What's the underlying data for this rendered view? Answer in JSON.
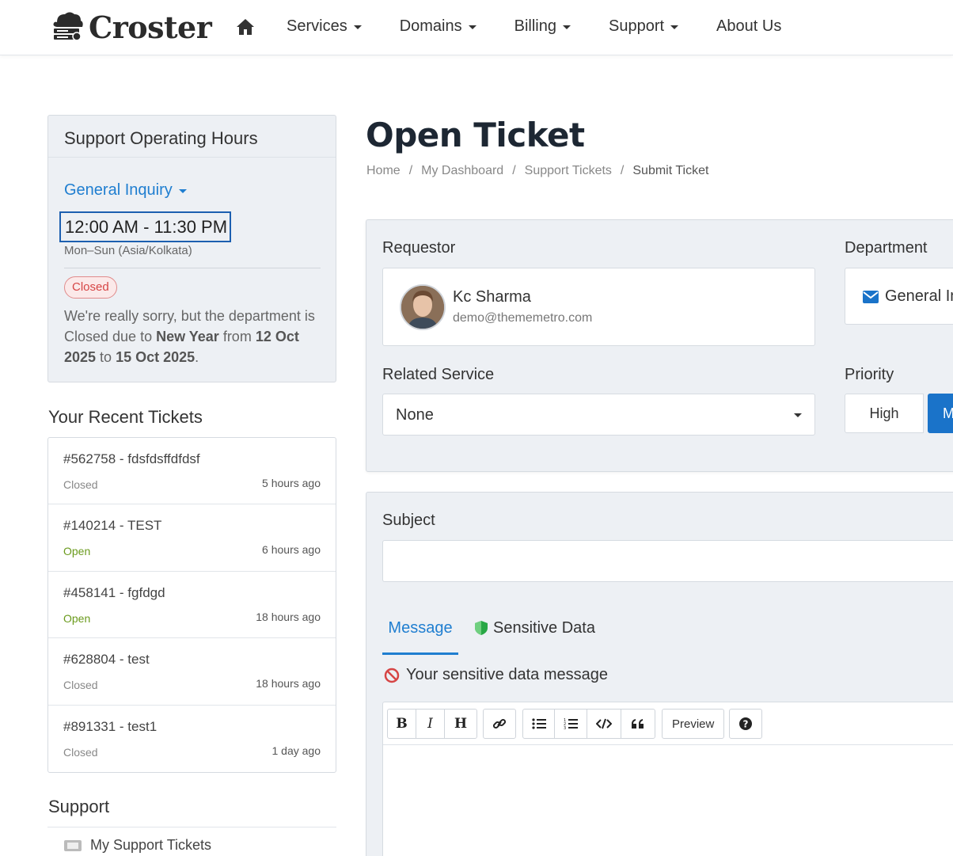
{
  "header": {
    "logo_text": "Croster",
    "nav": [
      {
        "label": "Services",
        "has_dropdown": true
      },
      {
        "label": "Domains",
        "has_dropdown": true
      },
      {
        "label": "Billing",
        "has_dropdown": true
      },
      {
        "label": "Support",
        "has_dropdown": true
      },
      {
        "label": "About Us",
        "has_dropdown": false
      }
    ]
  },
  "sidebar": {
    "hours_panel": {
      "title": "Support Operating Hours",
      "department": "General Inquiry",
      "hours": "12:00 AM - 11:30 PM",
      "days": "Mon–Sun (Asia/Kolkata)",
      "status": "Closed",
      "message": {
        "part1": "We're really sorry, but the department is Closed due to ",
        "reason": "New Year",
        "part2": " from ",
        "start": "12 Oct 2025",
        "part3": " to ",
        "end": "15 Oct 2025",
        "part4": "."
      }
    },
    "recent_title": "Your Recent Tickets",
    "tickets": [
      {
        "title": "#562758 - fdsfdsffdfdsf",
        "status": "Closed",
        "time": "5 hours ago"
      },
      {
        "title": "#140214 - TEST",
        "status": "Open",
        "time": "6 hours ago"
      },
      {
        "title": "#458141 - fgfdgd",
        "status": "Open",
        "time": "18 hours ago"
      },
      {
        "title": "#628804 - test",
        "status": "Closed",
        "time": "18 hours ago"
      },
      {
        "title": "#891331 - test1",
        "status": "Closed",
        "time": "1 day ago"
      }
    ],
    "support_title": "Support",
    "support_links": [
      {
        "label": "My Support Tickets"
      }
    ]
  },
  "main": {
    "title": "Open Ticket",
    "breadcrumb": [
      "Home",
      "My Dashboard",
      "Support Tickets",
      "Submit Ticket"
    ],
    "requestor": {
      "label": "Requestor",
      "name": "Kc Sharma",
      "email": "demo@thememetro.com"
    },
    "department": {
      "label": "Department",
      "value": "General In"
    },
    "related_service": {
      "label": "Related Service",
      "value": "None"
    },
    "priority": {
      "label": "Priority",
      "options": [
        "High",
        "M"
      ]
    },
    "subject": {
      "label": "Subject",
      "value": ""
    },
    "tabs": [
      "Message",
      "Sensitive Data"
    ],
    "sensitive_message": "Your sensitive data message",
    "editor": {
      "preview_label": "Preview"
    }
  },
  "colors": {
    "accent": "#1f7ed0",
    "primary_button": "#1a73c9",
    "closed_badge": "#d64545",
    "open_status": "#6a9a1c"
  }
}
